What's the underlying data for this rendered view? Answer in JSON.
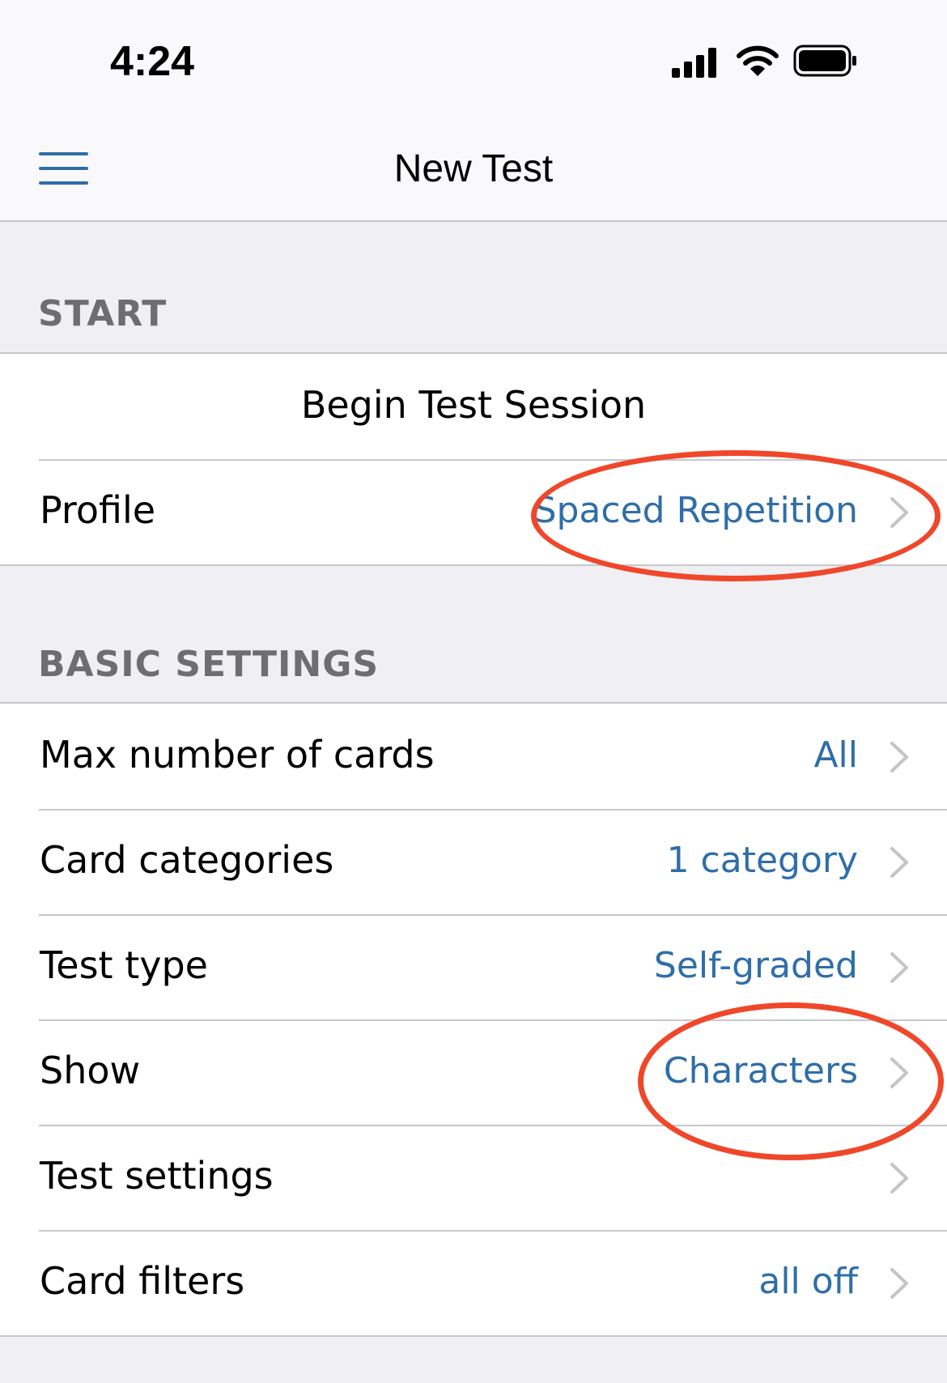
{
  "status": {
    "time": "4:24"
  },
  "nav": {
    "title": "New Test"
  },
  "sections": {
    "start": {
      "header": "START",
      "begin_label": "Begin Test Session",
      "profile": {
        "label": "Profile",
        "value": "Spaced Repetition"
      }
    },
    "basic": {
      "header": "BASIC SETTINGS",
      "rows": [
        {
          "label": "Max number of cards",
          "value": "All"
        },
        {
          "label": "Card categories",
          "value": "1 category"
        },
        {
          "label": "Test type",
          "value": "Self-graded"
        },
        {
          "label": "Show",
          "value": "Characters"
        },
        {
          "label": "Test settings",
          "value": ""
        },
        {
          "label": "Card filters",
          "value": "all off"
        }
      ]
    }
  },
  "colors": {
    "accent": "#2f6ea8",
    "highlight": "#f0472a",
    "background": "#efeff4"
  },
  "icons": [
    "hamburger-menu-icon",
    "cellular-signal-icon",
    "wifi-icon",
    "battery-icon",
    "chevron-right-icon"
  ]
}
